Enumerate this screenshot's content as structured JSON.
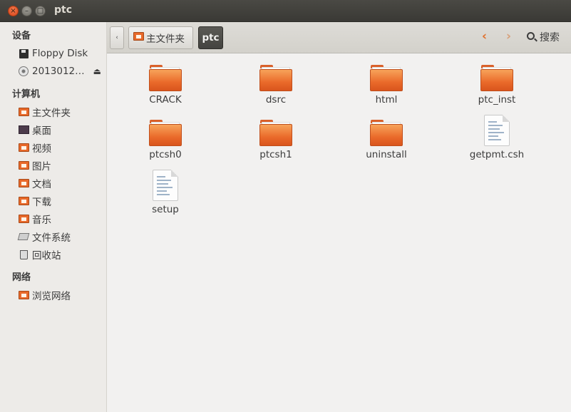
{
  "window": {
    "title": "ptc",
    "close_glyph": "×",
    "min_glyph": "–",
    "max_glyph": "□"
  },
  "sidebar": {
    "sections": [
      {
        "heading": "设备",
        "items": [
          {
            "label": "Floppy Disk",
            "icon": "floppy-icon"
          },
          {
            "label": "2013012…",
            "icon": "disc-icon",
            "eject": "⏏"
          }
        ]
      },
      {
        "heading": "计算机",
        "items": [
          {
            "label": "主文件夹",
            "icon": "home-folder-icon"
          },
          {
            "label": "桌面",
            "icon": "desktop-icon"
          },
          {
            "label": "视频",
            "icon": "video-icon"
          },
          {
            "label": "图片",
            "icon": "pictures-icon"
          },
          {
            "label": "文档",
            "icon": "documents-icon"
          },
          {
            "label": "下载",
            "icon": "downloads-icon"
          },
          {
            "label": "音乐",
            "icon": "music-icon"
          },
          {
            "label": "文件系统",
            "icon": "filesystem-icon"
          },
          {
            "label": "回收站",
            "icon": "trash-icon"
          }
        ]
      },
      {
        "heading": "网络",
        "items": [
          {
            "label": "浏览网络",
            "icon": "network-icon"
          }
        ]
      }
    ]
  },
  "toolbar": {
    "back_glyph": "‹",
    "crumb_home": "主文件夹",
    "crumb_current": "ptc",
    "prev_glyph": "‹",
    "next_glyph": "›",
    "search_label": "搜索"
  },
  "files": [
    {
      "name": "CRACK",
      "type": "folder"
    },
    {
      "name": "dsrc",
      "type": "folder"
    },
    {
      "name": "html",
      "type": "folder"
    },
    {
      "name": "ptc_inst",
      "type": "folder"
    },
    {
      "name": "ptcsh0",
      "type": "folder"
    },
    {
      "name": "ptcsh1",
      "type": "folder"
    },
    {
      "name": "uninstall",
      "type": "folder"
    },
    {
      "name": "getpmt.csh",
      "type": "text"
    },
    {
      "name": "setup",
      "type": "text"
    }
  ],
  "colors": {
    "accent_orange": "#e8692a",
    "background": "#f2f1f0",
    "titlebar": "#3c3b37"
  }
}
